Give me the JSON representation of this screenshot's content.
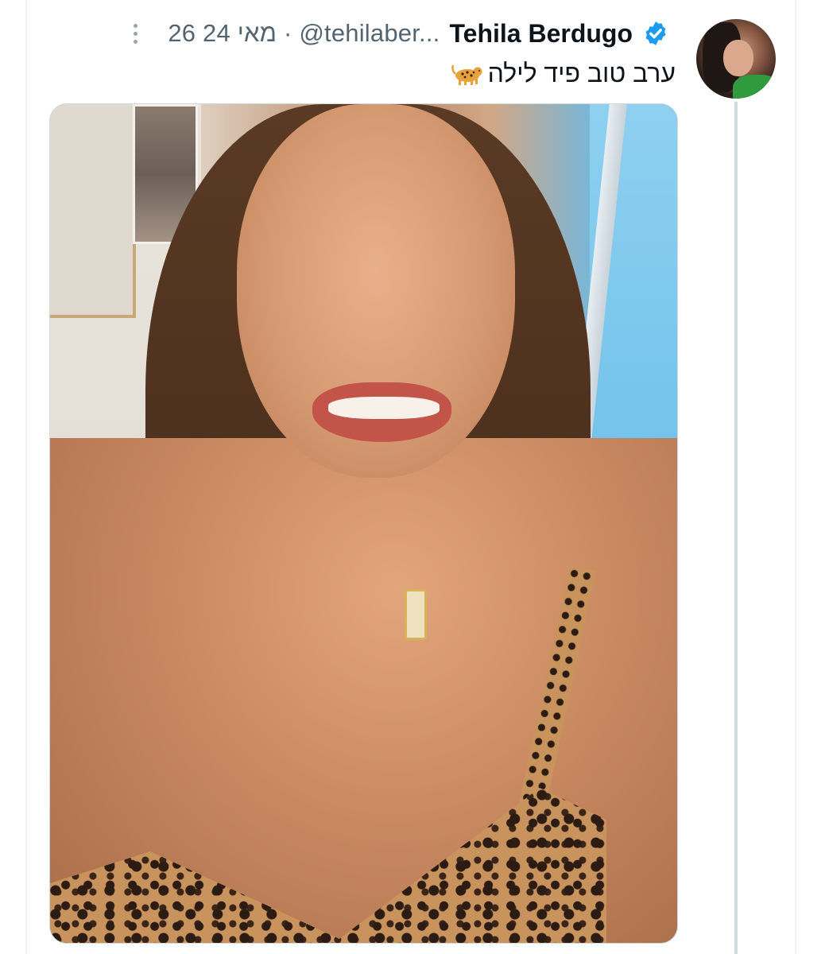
{
  "tweet": {
    "author_name": "Tehila Berdugo",
    "handle": "@tehilaber...",
    "separator": "·",
    "date": "26 מאי 24",
    "text": "ערב טוב פיד לילה",
    "emoji_icon": "leopard-icon",
    "verified_icon": "verified-badge-icon",
    "more_icon": "more-options-icon"
  },
  "colors": {
    "verified": "#1d9bf0",
    "name": "#0f1419",
    "meta": "#536471",
    "thread_line": "#cfd9de"
  }
}
